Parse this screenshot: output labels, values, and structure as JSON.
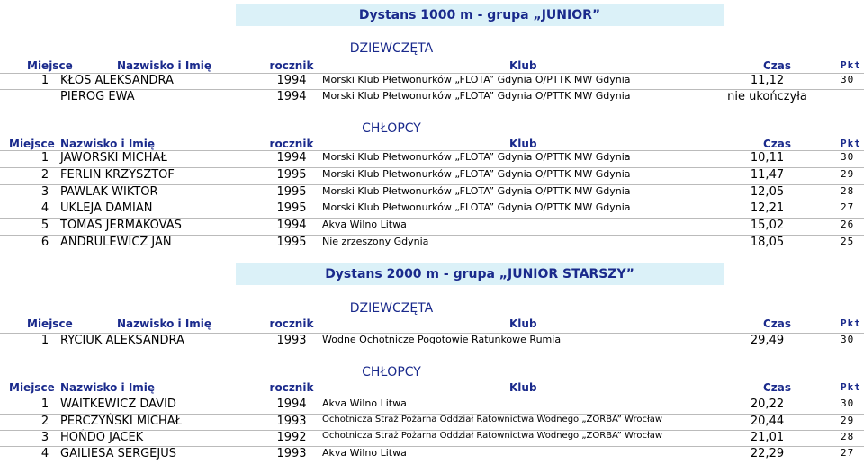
{
  "sections": [
    {
      "title": "Dystans 1000 m - grupa „JUNIOR”",
      "groups": [
        {
          "label": "DZIEWCZĘTA",
          "headers": {
            "miejsce": "Miejsce",
            "nazwisko": "Nazwisko i Imię",
            "rocznik": "rocznik",
            "klub": "Klub",
            "czas": "Czas",
            "pkt": "Pkt"
          },
          "rows": [
            {
              "m": "1",
              "n": "KŁOS ALEKSANDRA",
              "y": "1994",
              "k": "Morski Klub Płetwonurków „FLOTA” Gdynia O/PTTK MW Gdynia",
              "t": "11,12",
              "p": "30"
            },
            {
              "m": "",
              "n": "PIEROG EWA",
              "y": "1994",
              "k": "Morski Klub Płetwonurków „FLOTA” Gdynia O/PTTK MW Gdynia",
              "t": "nie ukończyła",
              "p": ""
            }
          ]
        },
        {
          "label": "CHŁOPCY",
          "headers": {
            "miejsce": "Miejsce",
            "nazwisko": "Nazwisko i Imię",
            "rocznik": "rocznik",
            "klub": "Klub",
            "czas": "Czas",
            "pkt": "Pkt"
          },
          "rows": [
            {
              "m": "1",
              "n": "JAWORSKI MICHAŁ",
              "y": "1994",
              "k": "Morski Klub Płetwonurków „FLOTA” Gdynia O/PTTK MW Gdynia",
              "t": "10,11",
              "p": "30"
            },
            {
              "m": "2",
              "n": "FERLIN KRZYSZTOF",
              "y": "1995",
              "k": "Morski Klub Płetwonurków „FLOTA” Gdynia O/PTTK MW Gdynia",
              "t": "11,47",
              "p": "29"
            },
            {
              "m": "3",
              "n": "PAWLAK WIKTOR",
              "y": "1995",
              "k": "Morski Klub Płetwonurków „FLOTA” Gdynia O/PTTK MW Gdynia",
              "t": "12,05",
              "p": "28"
            },
            {
              "m": "4",
              "n": "UKLEJA DAMIAN",
              "y": "1995",
              "k": "Morski Klub Płetwonurków „FLOTA” Gdynia O/PTTK MW Gdynia",
              "t": "12,21",
              "p": "27"
            },
            {
              "m": "5",
              "n": "TOMAS JERMAKOVAS",
              "y": "1994",
              "k": "Akva Wilno Litwa",
              "t": "15,02",
              "p": "26"
            },
            {
              "m": "6",
              "n": "ANDRULEWICZ JAN",
              "y": "1995",
              "k": "Nie zrzeszony Gdynia",
              "t": "18,05",
              "p": "25"
            }
          ]
        }
      ]
    },
    {
      "title": "Dystans 2000 m - grupa „JUNIOR STARSZY”",
      "groups": [
        {
          "label": "DZIEWCZĘTA",
          "headers": {
            "miejsce": "Miejsce",
            "nazwisko": "Nazwisko i Imię",
            "rocznik": "rocznik",
            "klub": "Klub",
            "czas": "Czas",
            "pkt": "Pkt"
          },
          "rows": [
            {
              "m": "1",
              "n": "RYCIUK ALEKSANDRA",
              "y": "1993",
              "k": "Wodne Ochotnicze Pogotowie Ratunkowe Rumia",
              "t": "29,49",
              "p": "30"
            }
          ]
        },
        {
          "label": "CHŁOPCY",
          "headers": {
            "miejsce": "Miejsce",
            "nazwisko": "Nazwisko i Imię",
            "rocznik": "rocznik",
            "klub": "Klub",
            "czas": "Czas",
            "pkt": "Pkt"
          },
          "rows": [
            {
              "m": "1",
              "n": "WAITKEWICZ DAVID",
              "y": "1994",
              "k": "Akva Wilno Litwa",
              "t": "20,22",
              "p": "30"
            },
            {
              "m": "2",
              "n": "PERCZYŃSKI MICHAŁ",
              "y": "1993",
              "k": "Ochotnicza Straż Pożarna Oddział Ratownictwa Wodnego „ZORBA” Wrocław",
              "t": "20,44",
              "p": "29"
            },
            {
              "m": "3",
              "n": "HOŃDO JACEK",
              "y": "1992",
              "k": "Ochotnicza Straż Pożarna Oddział Ratownictwa Wodnego „ZORBA” Wrocław",
              "t": "21,01",
              "p": "28"
            },
            {
              "m": "4",
              "n": "GAILIESA SERGEJUS",
              "y": "1993",
              "k": "Akva Wilno Litwa",
              "t": "22,29",
              "p": "27"
            }
          ]
        }
      ]
    }
  ]
}
